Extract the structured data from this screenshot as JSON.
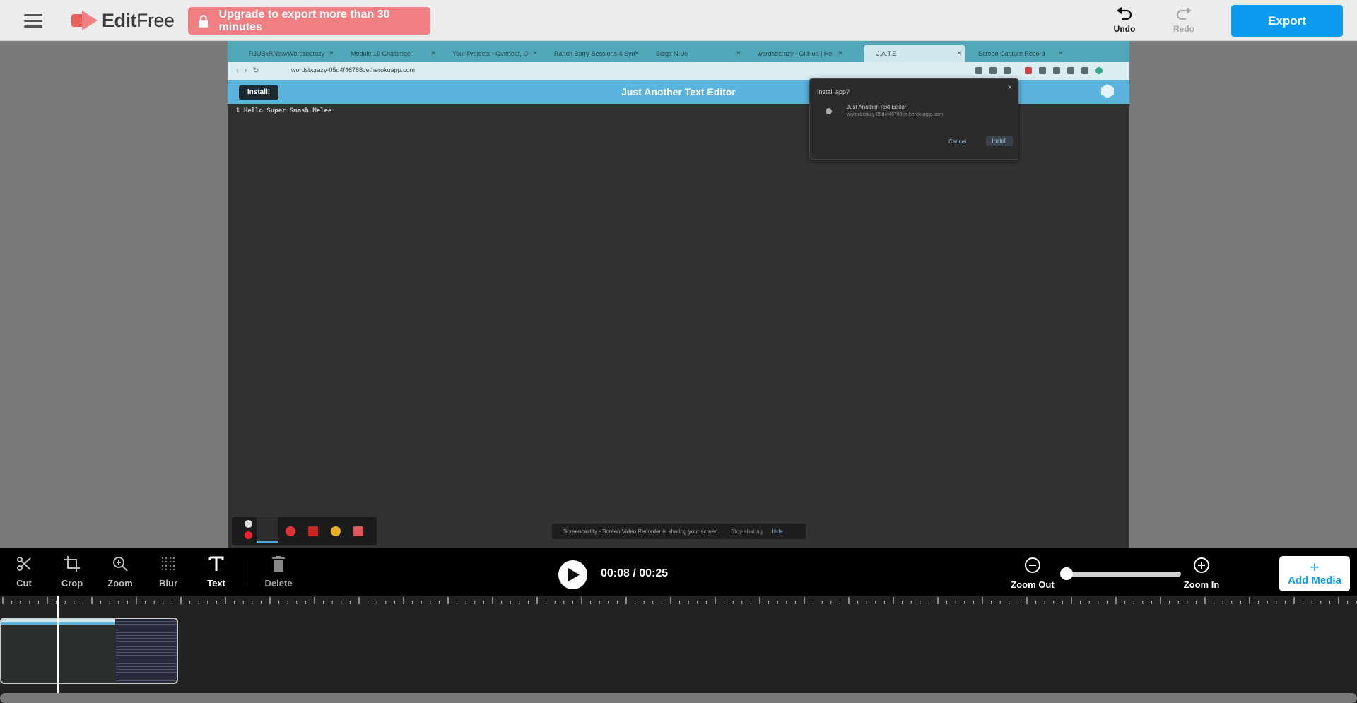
{
  "app": {
    "name_bold": "Edit",
    "name_light": "Free",
    "accent_color": "#0d9bf0",
    "upgrade_color": "#f07f83"
  },
  "topbar": {
    "upgrade_label": "Upgrade to export more than 30 minutes",
    "undo_label": "Undo",
    "redo_label": "Redo",
    "export_label": "Export"
  },
  "preview": {
    "browser_tabs": [
      {
        "label": "RJUSkRNew/Wordsbcrazy",
        "active": false
      },
      {
        "label": "Module 19 Challenge",
        "active": false
      },
      {
        "label": "Your Projects - Overleaf, O",
        "active": false
      },
      {
        "label": "Ranch Barry Sessions 4 Syn",
        "active": false
      },
      {
        "label": "Blogs N Us",
        "active": false
      },
      {
        "label": "wordsbcrazy - GitHub | He",
        "active": false
      },
      {
        "label": "J.A.T.E",
        "active": true
      },
      {
        "label": "Screen Capture Record",
        "active": false
      }
    ],
    "url": "wordsbcrazy-05d4f46788ce.herokuapp.com",
    "install_button": "Install!",
    "app_title": "Just Another Text Editor",
    "editor_text": "1 Hello Super Smash Melee",
    "dialog": {
      "title": "Install app?",
      "app_name": "Just Another Text Editor",
      "app_url": "wordsbcrazy-05d4f46788ce.herokuapp.com",
      "cancel": "Cancel",
      "install": "Install",
      "close": "×"
    },
    "share_notice": "Screencastify - Screen Video Recorder is sharing your screen.",
    "share_stop": "Stop sharing",
    "share_hide": "Hide"
  },
  "toolbar": {
    "tools": {
      "cut": "Cut",
      "crop": "Crop",
      "zoom": "Zoom",
      "blur": "Blur",
      "text": "Text",
      "delete": "Delete"
    },
    "time_display": "00:08 / 00:25",
    "zoom_out": "Zoom Out",
    "zoom_in": "Zoom In",
    "zoom_level": 0,
    "add_media": "Add Media",
    "add_media_icon": "+"
  },
  "timeline": {
    "current_time_seconds": 8,
    "total_time_seconds": 25
  },
  "icons": {
    "menu": "hamburger-icon",
    "logo": "video-camera-icon",
    "lock": "lock-icon",
    "undo": "undo-arrow-icon",
    "redo": "redo-arrow-icon",
    "cut": "scissors-icon",
    "crop": "crop-icon",
    "zoom": "magnifier-plus-icon",
    "blur": "dot-grid-icon",
    "text": "text-T-icon",
    "delete": "trash-icon",
    "play": "play-icon",
    "zoom_out": "circle-minus-icon",
    "zoom_in": "circle-plus-icon"
  }
}
